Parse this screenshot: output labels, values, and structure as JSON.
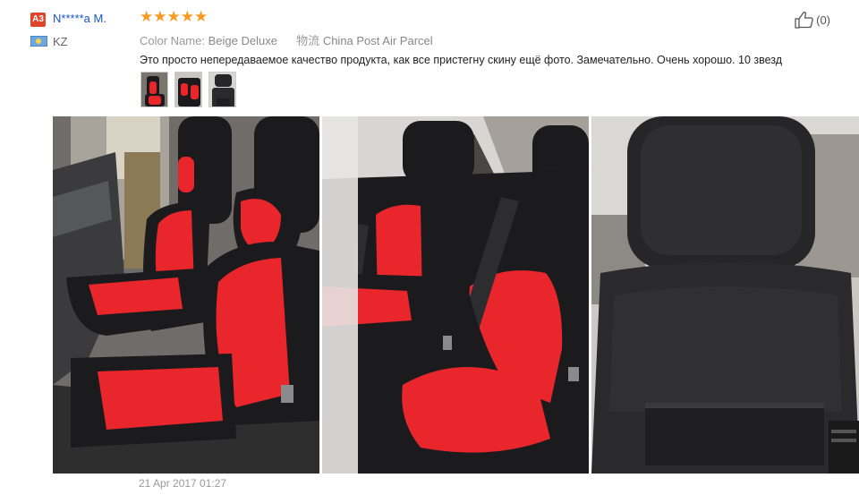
{
  "reviewer": {
    "badge": "A3",
    "name": "N*****a M.",
    "country": "KZ"
  },
  "rating": {
    "stars": 5,
    "star_char": "★"
  },
  "meta": {
    "color_label": "Color Name:",
    "color_value": "Beige Deluxe",
    "shipping_label": "物流",
    "shipping_value": "China Post Air Parcel"
  },
  "helpful": {
    "count": "(0)"
  },
  "review_text": "Это просто непередаваемое качество продукта, как все пристегну скину ещё фото. Замечательно. Очень хорошо. 10 звезд",
  "date": "21 Apr 2017 01:27",
  "colors": {
    "name_link": "#1a56c2",
    "star": "#f79a20",
    "badge": "#e0442b",
    "seat_red": "#e8262c",
    "seat_black": "#1b1b1d"
  }
}
